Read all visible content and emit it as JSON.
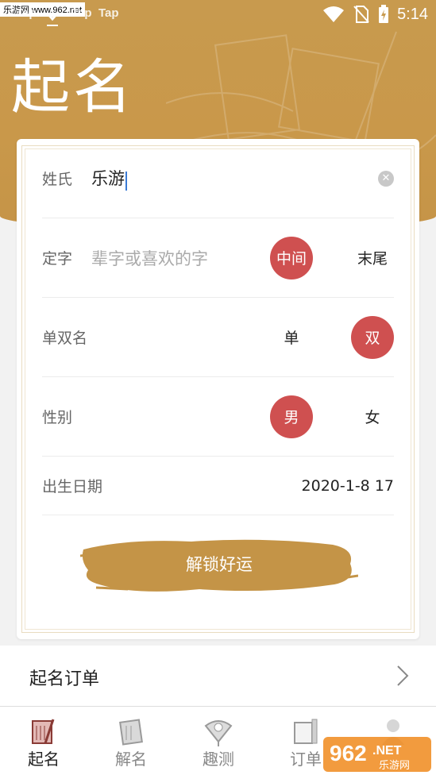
{
  "status_bar": {
    "watermark": "乐游网 www.962.net",
    "tap_labels": [
      "Tap",
      "Tap",
      "Tap"
    ],
    "time": "5:14"
  },
  "header": {
    "title": "起名"
  },
  "form": {
    "surname": {
      "label": "姓氏",
      "value": "乐游"
    },
    "fixed_char": {
      "label": "定字",
      "placeholder": "辈字或喜欢的字",
      "options": [
        {
          "label": "中间",
          "selected": true
        },
        {
          "label": "末尾",
          "selected": false
        }
      ]
    },
    "name_length": {
      "label": "单双名",
      "options": [
        {
          "label": "单",
          "selected": false
        },
        {
          "label": "双",
          "selected": true
        }
      ]
    },
    "gender": {
      "label": "性别",
      "options": [
        {
          "label": "男",
          "selected": true
        },
        {
          "label": "女",
          "selected": false
        }
      ]
    },
    "birth": {
      "label": "出生日期",
      "value": "2020-1-8 17"
    },
    "submit_label": "解锁好运"
  },
  "orders": {
    "label": "起名订单"
  },
  "nav": {
    "items": [
      {
        "label": "起名",
        "active": true
      },
      {
        "label": "解名",
        "active": false
      },
      {
        "label": "趣测",
        "active": false
      },
      {
        "label": "订单",
        "active": false
      },
      {
        "label": "",
        "active": false
      }
    ]
  },
  "watermark_logo": {
    "number": "962",
    "suffix": ".NET",
    "text": "乐游网"
  },
  "colors": {
    "header": "#c89a4e",
    "accent": "#cf5050",
    "brush": "#c49447"
  }
}
